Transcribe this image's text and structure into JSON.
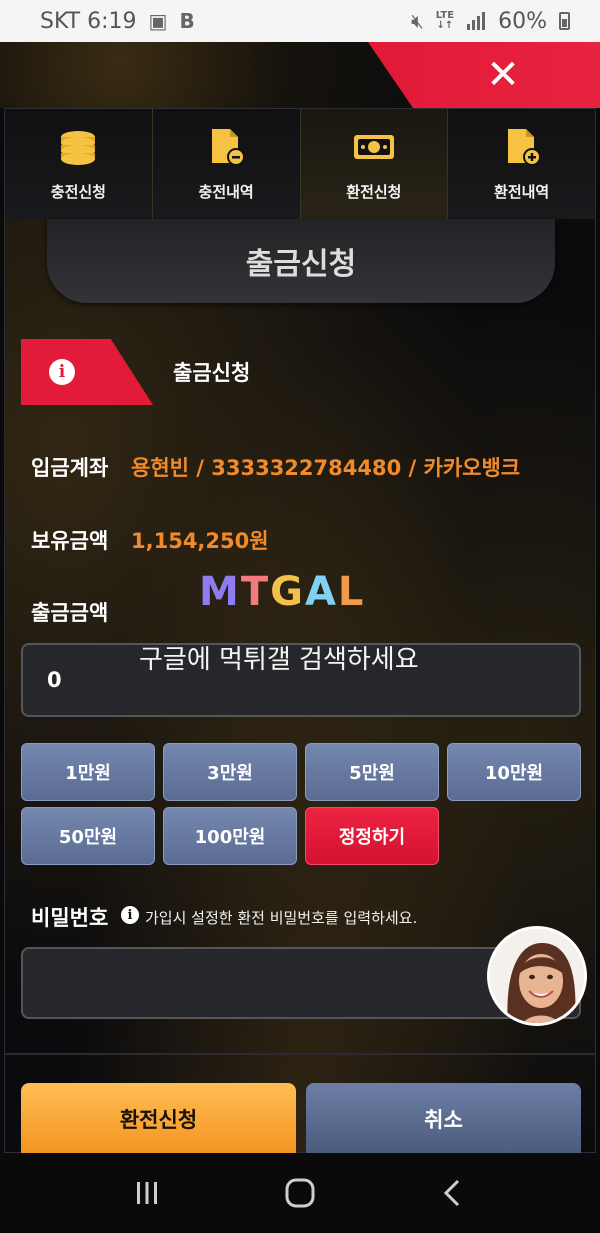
{
  "status_bar": {
    "carrier_time": "SKT 6:19",
    "network": "LTE",
    "battery": "60%"
  },
  "tabs": [
    {
      "label": "충전신청",
      "icon": "coins-icon"
    },
    {
      "label": "충전내역",
      "icon": "document-minus-icon"
    },
    {
      "label": "환전신청",
      "icon": "cash-icon"
    },
    {
      "label": "환전내역",
      "icon": "document-plus-icon"
    }
  ],
  "active_tab": 2,
  "page_title": "출금신청",
  "info_title": "출금신청",
  "account": {
    "deposit_label": "입금계좌",
    "deposit_value": "용현빈 / 3333322784480 / 카카오뱅크",
    "balance_label": "보유금액",
    "balance_value": "1,154,250원",
    "amount_label": "출금금액",
    "amount_value": "0"
  },
  "watermark": {
    "logo": "MTGAL",
    "text": "구글에 먹튀갤 검색하세요"
  },
  "amount_buttons": [
    "1만원",
    "3만원",
    "5만원",
    "10만원",
    "50만원",
    "100만원"
  ],
  "reset_button": "정정하기",
  "password": {
    "label": "비밀번호",
    "hint": "가입시 설정한 환전 비밀번호를 입력하세요.",
    "value": ""
  },
  "actions": {
    "submit": "환전신청",
    "cancel": "취소"
  },
  "colors": {
    "accent_red": "#e31b3a",
    "accent_orange": "#f28a2b",
    "button_blue": "#6477a0"
  }
}
